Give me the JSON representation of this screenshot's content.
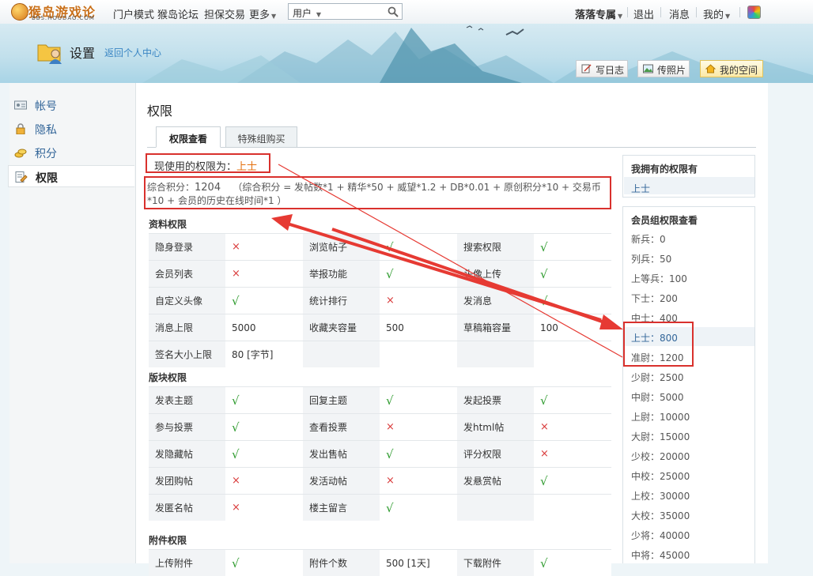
{
  "topbar": {
    "logo_text": "猴岛游戏论坛",
    "logo_sub": "BBS.HOUDAO.COM",
    "nav": [
      "门户模式",
      "猴岛论坛",
      "担保交易",
      "更多"
    ],
    "search_select": "用户",
    "search_placeholder": "",
    "user": "落落专属",
    "logout": "退出",
    "messages": "消息",
    "mine": "我的"
  },
  "header": {
    "title": "设置",
    "back_link": "返回个人中心",
    "buttons": {
      "blog": "写日志",
      "photo": "传照片",
      "space": "我的空间"
    }
  },
  "sidebar": {
    "items": [
      {
        "label": "帐号",
        "icon": "id-card-icon"
      },
      {
        "label": "隐私",
        "icon": "lock-icon"
      },
      {
        "label": "积分",
        "icon": "coins-icon"
      },
      {
        "label": "权限",
        "icon": "permission-doc-icon"
      }
    ],
    "active_index": 3
  },
  "main": {
    "title": "权限",
    "tabs": [
      "权限查看",
      "特殊组购买"
    ],
    "current_label": "现使用的权限为：",
    "current_value": "上士",
    "score_label": "综合积分：",
    "score_value": "1204",
    "formula_line1": "（综合积分 = 发帖数*1 + 精华*50 + 威望*1.2 + DB*0.01 + 原创积分*10 + 交易币",
    "formula_line2": "*10 + 会员的历史在线时间*1 ）",
    "sections": [
      {
        "title": "资料权限",
        "rows": [
          [
            [
              "隐身登录",
              "no"
            ],
            [
              "浏览帖子",
              "yes"
            ],
            [
              "搜索权限",
              "yes"
            ]
          ],
          [
            [
              "会员列表",
              "no"
            ],
            [
              "举报功能",
              "yes"
            ],
            [
              "头像上传",
              "yes"
            ]
          ],
          [
            [
              "自定义头像",
              "yes"
            ],
            [
              "统计排行",
              "no"
            ],
            [
              "发消息",
              "yes"
            ]
          ],
          [
            [
              "消息上限",
              "5000"
            ],
            [
              "收藏夹容量",
              "500"
            ],
            [
              "草稿箱容量",
              "100"
            ]
          ],
          [
            [
              "签名大小上限",
              "80 [字节]"
            ],
            [
              "",
              ""
            ],
            [
              "",
              ""
            ]
          ]
        ]
      },
      {
        "title": "版块权限",
        "rows": [
          [
            [
              "发表主题",
              "yes"
            ],
            [
              "回复主题",
              "yes"
            ],
            [
              "发起投票",
              "yes"
            ]
          ],
          [
            [
              "参与投票",
              "yes"
            ],
            [
              "查看投票",
              "no"
            ],
            [
              "发html帖",
              "no"
            ]
          ],
          [
            [
              "发隐藏帖",
              "yes"
            ],
            [
              "发出售帖",
              "yes"
            ],
            [
              "评分权限",
              "no"
            ]
          ],
          [
            [
              "发团购帖",
              "no"
            ],
            [
              "发活动帖",
              "no"
            ],
            [
              "发悬赏帖",
              "yes"
            ]
          ],
          [
            [
              "发匿名帖",
              "no"
            ],
            [
              "楼主留言",
              "yes"
            ],
            [
              "",
              ""
            ]
          ]
        ]
      },
      {
        "title": "附件权限",
        "rows": [
          [
            [
              "上传附件",
              "yes"
            ],
            [
              "附件个数",
              "500 [1天]"
            ],
            [
              "下载附件",
              "yes"
            ]
          ]
        ]
      }
    ]
  },
  "right": {
    "own_title": "我拥有的权限有",
    "own_value": "上士",
    "groups_title": "会员组权限查看",
    "grades": [
      {
        "name": "新兵",
        "points": "0"
      },
      {
        "name": "列兵",
        "points": "50"
      },
      {
        "name": "上等兵",
        "points": "100"
      },
      {
        "name": "下士",
        "points": "200"
      },
      {
        "name": "中士",
        "points": "400"
      },
      {
        "name": "上士",
        "points": "800"
      },
      {
        "name": "准尉",
        "points": "1200"
      },
      {
        "name": "少尉",
        "points": "2500"
      },
      {
        "name": "中尉",
        "points": "5000"
      },
      {
        "name": "上尉",
        "points": "10000"
      },
      {
        "name": "大尉",
        "points": "15000"
      },
      {
        "name": "少校",
        "points": "20000"
      },
      {
        "name": "中校",
        "points": "25000"
      },
      {
        "name": "上校",
        "points": "30000"
      },
      {
        "name": "大校",
        "points": "35000"
      },
      {
        "name": "少将",
        "points": "40000"
      },
      {
        "name": "中将",
        "points": "45000"
      }
    ],
    "highlight_name": "上士"
  },
  "symbols": {
    "yes": "√",
    "no": "×"
  },
  "colors": {
    "accent_link": "#336699",
    "current_value": "#e4700e",
    "annotation_red": "#d9312d",
    "yes": "#2e9b2e",
    "no": "#d93b3b"
  }
}
